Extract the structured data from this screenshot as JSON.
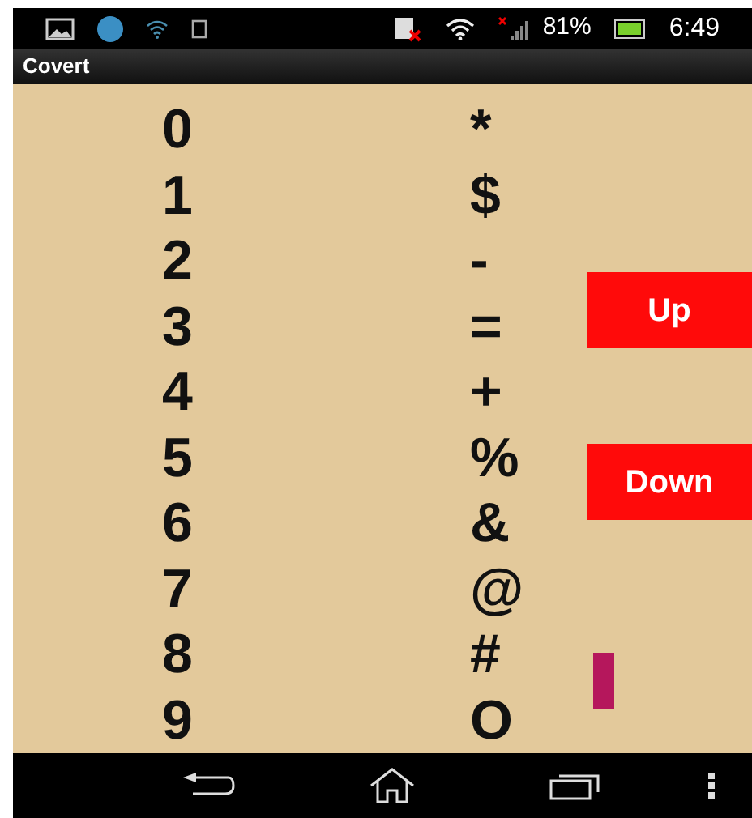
{
  "status_bar": {
    "battery": "81%",
    "time": "6:49"
  },
  "app_bar": {
    "title": "Covert"
  },
  "rows": [
    {
      "digit": "0",
      "symbol": "*"
    },
    {
      "digit": "1",
      "symbol": "$"
    },
    {
      "digit": "2",
      "symbol": "-"
    },
    {
      "digit": "3",
      "symbol": "="
    },
    {
      "digit": "4",
      "symbol": "+"
    },
    {
      "digit": "5",
      "symbol": "%"
    },
    {
      "digit": "6",
      "symbol": "&"
    },
    {
      "digit": "7",
      "symbol": "@"
    },
    {
      "digit": "8",
      "symbol": "#"
    },
    {
      "digit": "9",
      "symbol": "O"
    }
  ],
  "buttons": [
    {
      "label": "Up"
    },
    {
      "label": "Down"
    }
  ]
}
